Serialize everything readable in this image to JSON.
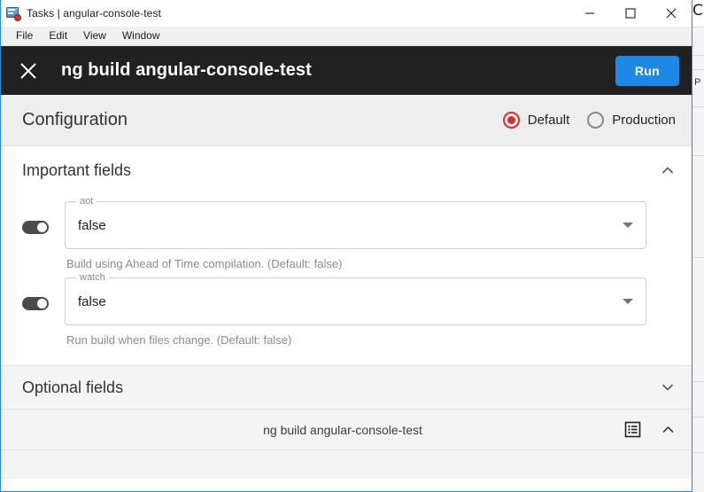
{
  "window": {
    "title": "Tasks | angular-console-test",
    "app_icon": "tasks-app-icon",
    "controls": [
      {
        "name": "minimize",
        "icon": "minimize-icon"
      },
      {
        "name": "maximize",
        "icon": "maximize-icon"
      },
      {
        "name": "close",
        "icon": "close-icon"
      }
    ]
  },
  "menubar": {
    "items": [
      {
        "label": "File"
      },
      {
        "label": "Edit"
      },
      {
        "label": "View"
      },
      {
        "label": "Window"
      }
    ]
  },
  "task_header": {
    "close_icon": "close-icon",
    "title": "ng build angular-console-test",
    "run_label": "Run",
    "run_color": "#1e88e5",
    "background": "#212121"
  },
  "configuration": {
    "title": "Configuration",
    "accent_color": "#db2b2b",
    "options": [
      {
        "label": "Default",
        "selected": true
      },
      {
        "label": "Production",
        "selected": false
      }
    ]
  },
  "sections": {
    "important": {
      "title": "Important fields",
      "expanded": true,
      "chevron": "chevron-up-icon",
      "fields": [
        {
          "label": "aot",
          "value": "false",
          "helper": "Build using Ahead of Time compilation. (Default: false)",
          "toggle_on": true,
          "arrow": "dropdown-arrow-icon"
        },
        {
          "label": "watch",
          "value": "false",
          "helper": "Run build when files change. (Default: false)",
          "toggle_on": true,
          "arrow": "dropdown-arrow-icon"
        }
      ]
    },
    "optional": {
      "title": "Optional fields",
      "expanded": false,
      "chevron": "chevron-down-icon"
    }
  },
  "command_bar": {
    "command": "ng build angular-console-test",
    "output_icon": "terminal-output-icon",
    "chevron": "chevron-up-icon"
  },
  "background_window": {
    "glyph": "C",
    "letter": "P"
  }
}
